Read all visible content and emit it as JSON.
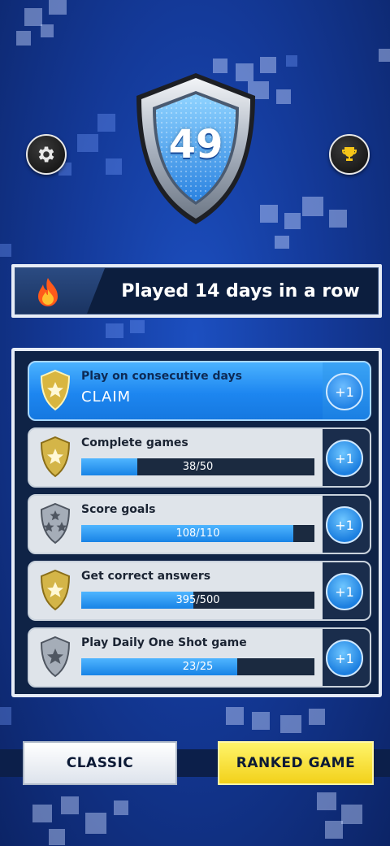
{
  "level": "49",
  "top_icons": {
    "settings": "gear-icon",
    "trophy": "trophy-icon"
  },
  "streak": {
    "icon": "fire-icon",
    "text": "Played 14 days in a row"
  },
  "missions": [
    {
      "title": "Play on consecutive days",
      "status": "CLAIM",
      "reward": "+1",
      "badge": "gold",
      "active": true
    },
    {
      "title": "Complete games",
      "progress": "38/50",
      "fraction": 0.24,
      "reward": "+1",
      "badge": "gold"
    },
    {
      "title": "Score goals",
      "progress": "108/110",
      "fraction": 0.91,
      "reward": "+1",
      "badge": "silver"
    },
    {
      "title": "Get correct answers",
      "progress": "395/500",
      "fraction": 0.48,
      "reward": "+1",
      "badge": "gold"
    },
    {
      "title": "Play Daily One Shot game",
      "progress": "23/25",
      "fraction": 0.67,
      "reward": "+1",
      "badge": "silver"
    }
  ],
  "buttons": {
    "classic": "CLASSIC",
    "ranked": "RANKED GAME"
  },
  "colors": {
    "accent_blue": "#1d86f0",
    "ranked_yellow": "#f2d11a",
    "background": "#143a9a"
  }
}
